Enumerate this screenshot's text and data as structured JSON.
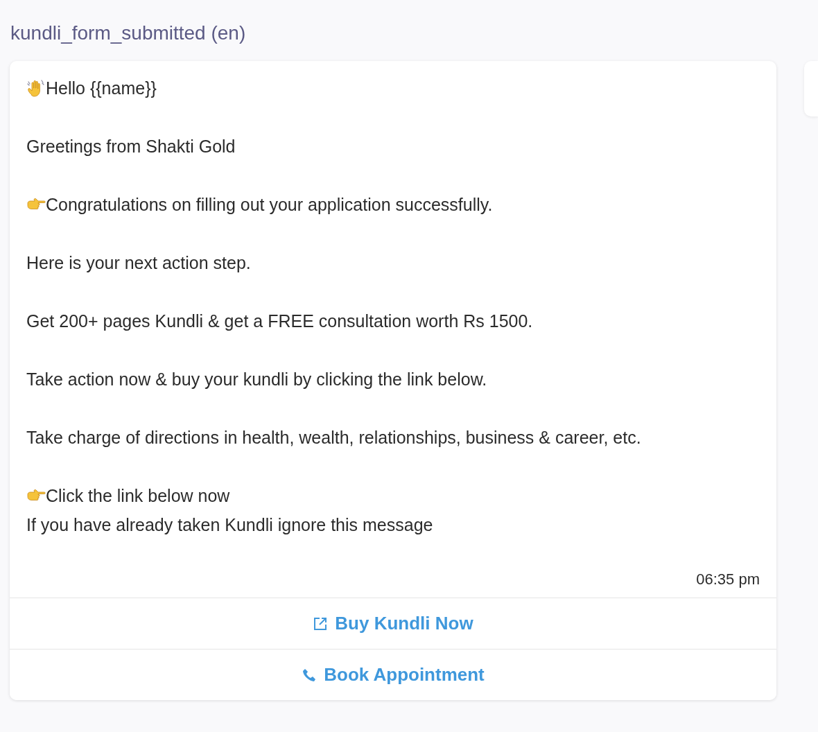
{
  "template": {
    "title": "kundli_form_submitted (en)"
  },
  "message": {
    "paragraphs": [
      {
        "kind": "greeting",
        "lines": [
          "Hello {{name}}"
        ]
      },
      {
        "kind": "plain",
        "lines": [
          "Greetings from Shakti Gold"
        ]
      },
      {
        "kind": "pointer",
        "lines": [
          "Congratulations on filling out your application successfully."
        ]
      },
      {
        "kind": "plain",
        "lines": [
          "Here is your next action step."
        ]
      },
      {
        "kind": "plain",
        "lines": [
          "Get 200+ pages Kundli & get a FREE consultation worth Rs 1500."
        ]
      },
      {
        "kind": "plain",
        "lines": [
          "Take action now & buy your kundli by clicking the link below."
        ]
      },
      {
        "kind": "plain",
        "lines": [
          "Take charge of directions in health, wealth, relationships, business & career, etc."
        ]
      },
      {
        "kind": "pointer",
        "lines": [
          "Click the link below now",
          "If you have already taken Kundli ignore this message"
        ]
      }
    ],
    "time": "06:35 pm",
    "buttons": [
      {
        "kind": "link",
        "label": "Buy Kundli Now"
      },
      {
        "kind": "call",
        "label": "Book Appointment"
      }
    ]
  }
}
